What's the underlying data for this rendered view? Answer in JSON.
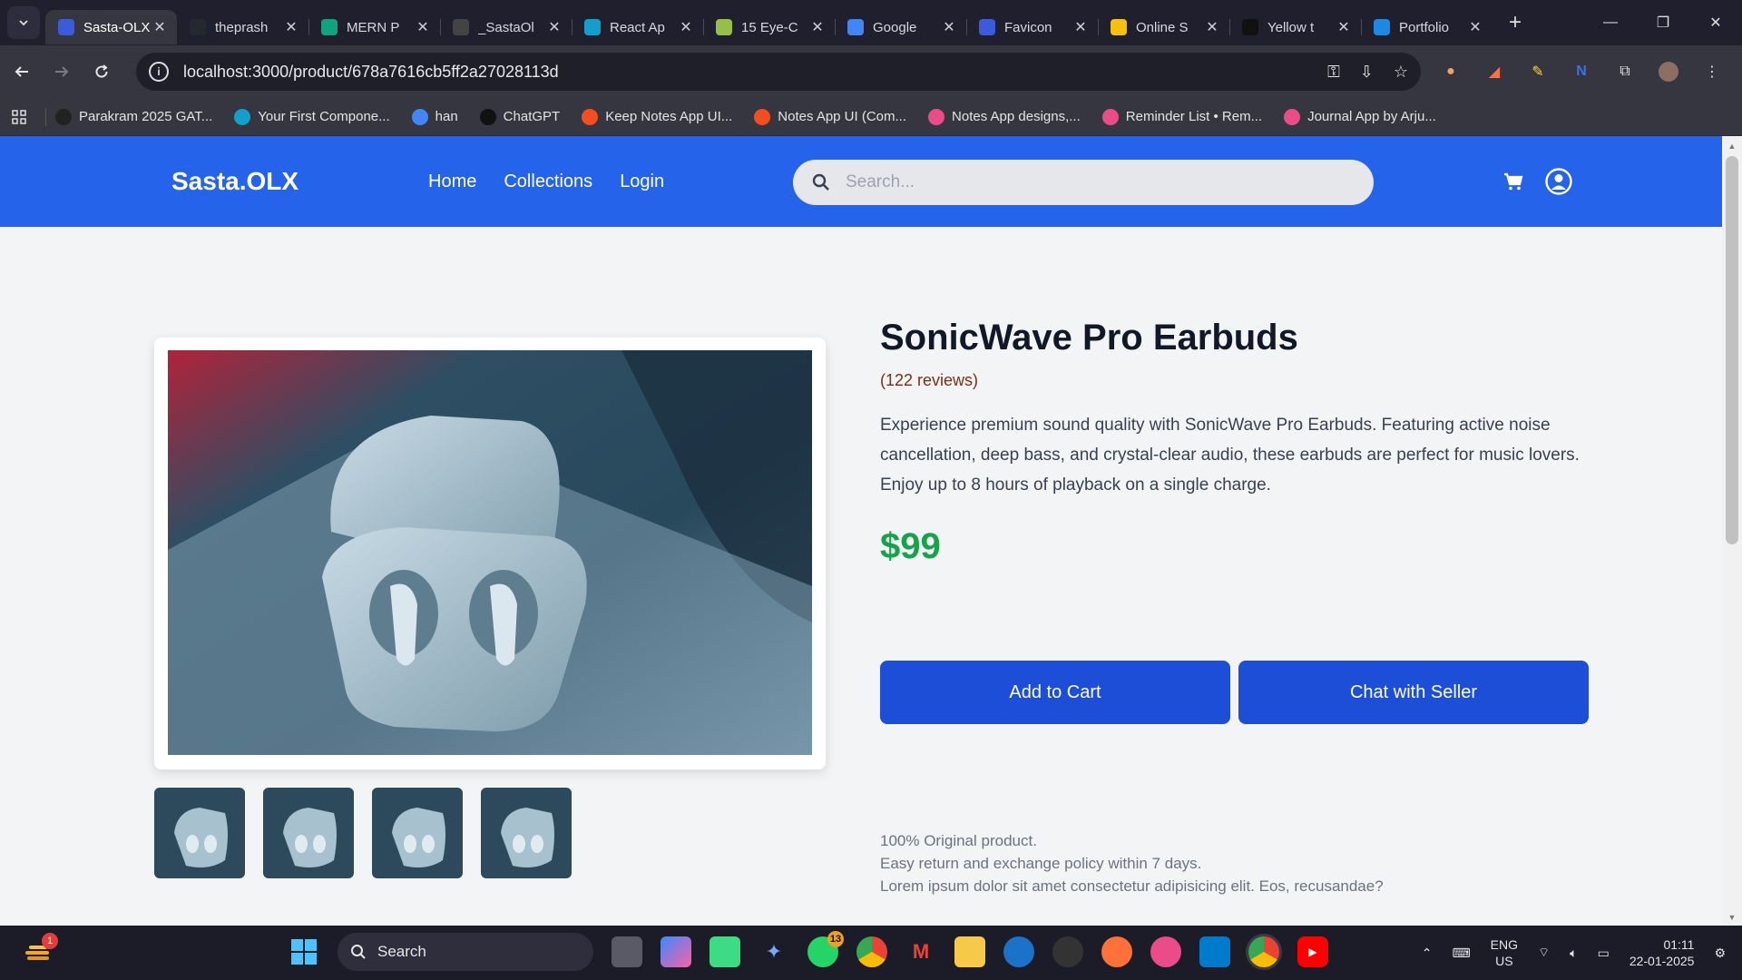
{
  "browser": {
    "tabs": [
      {
        "title": "Sasta-OLX",
        "icon_color": "#3b5bdb",
        "active": true
      },
      {
        "title": "theprash",
        "icon_color": "#24292f"
      },
      {
        "title": "MERN P",
        "icon_color": "#10a37f"
      },
      {
        "title": "_SastaOl",
        "icon_color": "#444444"
      },
      {
        "title": "React Ap",
        "icon_color": "#149eca"
      },
      {
        "title": "15 Eye-C",
        "icon_color": "#95bf47"
      },
      {
        "title": "Google",
        "icon_color": "#4285f4"
      },
      {
        "title": "Favicon",
        "icon_color": "#3b5bdb"
      },
      {
        "title": "Online S",
        "icon_color": "#f4c20d"
      },
      {
        "title": "Yellow t",
        "icon_color": "#111111"
      },
      {
        "title": "Portfolio",
        "icon_color": "#1e88e5"
      }
    ],
    "url": "localhost:3000/product/678a7616cb5ff2a27028113d",
    "bookmarks": [
      {
        "label": "Parakram 2025 GAT...",
        "color": "#222222"
      },
      {
        "label": "Your First Compone...",
        "color": "#149eca"
      },
      {
        "label": "han",
        "color": "#4285f4"
      },
      {
        "label": "ChatGPT",
        "color": "#111111"
      },
      {
        "label": "Keep Notes App UI...",
        "color": "#f24e1e"
      },
      {
        "label": "Notes App UI (Com...",
        "color": "#f24e1e"
      },
      {
        "label": "Notes App designs,...",
        "color": "#ea4c89"
      },
      {
        "label": "Reminder List • Rem...",
        "color": "#ea4c89"
      },
      {
        "label": "Journal App by Arju...",
        "color": "#ea4c89"
      }
    ]
  },
  "header": {
    "brand": "Sasta.OLX",
    "nav": [
      "Home",
      "Collections",
      "Login"
    ],
    "search_placeholder": "Search..."
  },
  "product": {
    "title": "SonicWave Pro Earbuds",
    "reviews": "(122 reviews)",
    "description": "Experience premium sound quality with SonicWave Pro Earbuds. Featuring active noise cancellation, deep bass, and crystal-clear audio, these earbuds are perfect for music lovers. Enjoy up to 8 hours of playback on a single charge.",
    "price": "$99",
    "add_to_cart": "Add to Cart",
    "chat_seller": "Chat with Seller",
    "policy": [
      "100% Original product.",
      "Easy return and exchange policy within 7 days.",
      "Lorem ipsum dolor sit amet consectetur adipisicing elit. Eos, recusandae?"
    ]
  },
  "taskbar": {
    "search_label": "Search",
    "notification_count": "1",
    "whatsapp_badge": "13",
    "lang": "ENG",
    "region": "US",
    "time": "01:11",
    "date": "22-01-2025"
  },
  "colors": {
    "accent": "#2563eb",
    "button": "#1d4ed8",
    "price": "#16a34a"
  }
}
